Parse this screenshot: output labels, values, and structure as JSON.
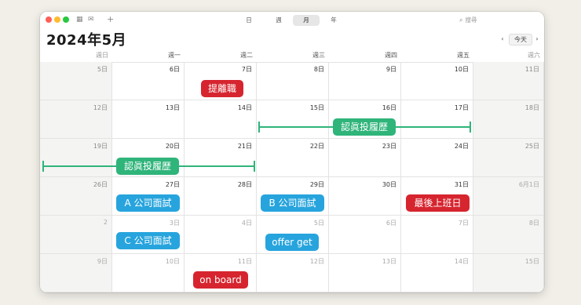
{
  "window_controls": [
    "close",
    "minimize",
    "zoom"
  ],
  "toolbar": {
    "calendar_icon": "calendar-icon",
    "inbox_icon": "inbox-icon",
    "add_label": "+",
    "view_tabs": [
      {
        "label": "日",
        "active": false
      },
      {
        "label": "週",
        "active": false
      },
      {
        "label": "月",
        "active": true
      },
      {
        "label": "年",
        "active": false
      }
    ],
    "search_icon": "magnifier-icon",
    "search_placeholder": "搜尋"
  },
  "header": {
    "title": "2024年5月",
    "prev_label": "‹",
    "today_label": "今天",
    "next_label": "›"
  },
  "weekdays": [
    "週日",
    "週一",
    "週二",
    "週三",
    "週四",
    "週五",
    "週六"
  ],
  "weeks": [
    [
      "5日",
      "6日",
      "7日",
      "8日",
      "9日",
      "10日",
      "11日"
    ],
    [
      "12日",
      "13日",
      "14日",
      "15日",
      "16日",
      "17日",
      "18日"
    ],
    [
      "19日",
      "20日",
      "21日",
      "22日",
      "23日",
      "24日",
      "25日"
    ],
    [
      "26日",
      "27日",
      "28日",
      "29日",
      "30日",
      "31日",
      "6月1日"
    ],
    [
      "2",
      "3日",
      "4日",
      "5日",
      "6日",
      "7日",
      "8日"
    ],
    [
      "9日",
      "10日",
      "11日",
      "12日",
      "13日",
      "14日",
      "15日"
    ]
  ],
  "events": {
    "resign": "提離職",
    "apply1": "認眞投履歴",
    "apply2": "認眞投履歴",
    "interview_a": "A 公司面試",
    "interview_b": "B 公司面試",
    "last_day": "最後上班日",
    "interview_c": "C 公司面試",
    "offer": "offer get",
    "onboard": "on board"
  },
  "colors": {
    "red": "#d6252f",
    "blue": "#27a4dd",
    "green": "#2fb47a"
  }
}
